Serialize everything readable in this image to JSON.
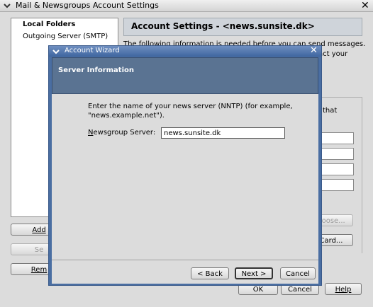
{
  "window": {
    "title": "Mail & Newsgroups Account Settings"
  },
  "sidebar": {
    "items": [
      {
        "label": "Local Folders"
      },
      {
        "label": "Outgoing Server (SMTP)"
      }
    ],
    "buttons": {
      "add": "Add",
      "set": "Se",
      "remove": "Rem"
    }
  },
  "settings": {
    "header": "Account Settings - <news.sunsite.dk>",
    "desc_line1": "The following information is needed before you can send messages.",
    "desc_line2": "act your",
    "frag_that": "that",
    "choose_button": "hoose...",
    "card_button": "Card...",
    "ok_button": "OK",
    "cancel_button": "Cancel",
    "help_button": "Help"
  },
  "wizard": {
    "title": "Account Wizard",
    "header": "Server Information",
    "instruction": "Enter the name of your news server (NNTP) (for example,\n\"news.example.net\").",
    "server_label_first": "N",
    "server_label_rest": "ewsgroup Server:",
    "server_value": "news.sunsite.dk",
    "back_button": "< Back",
    "next_button": "Next >",
    "cancel_button": "Cancel"
  }
}
